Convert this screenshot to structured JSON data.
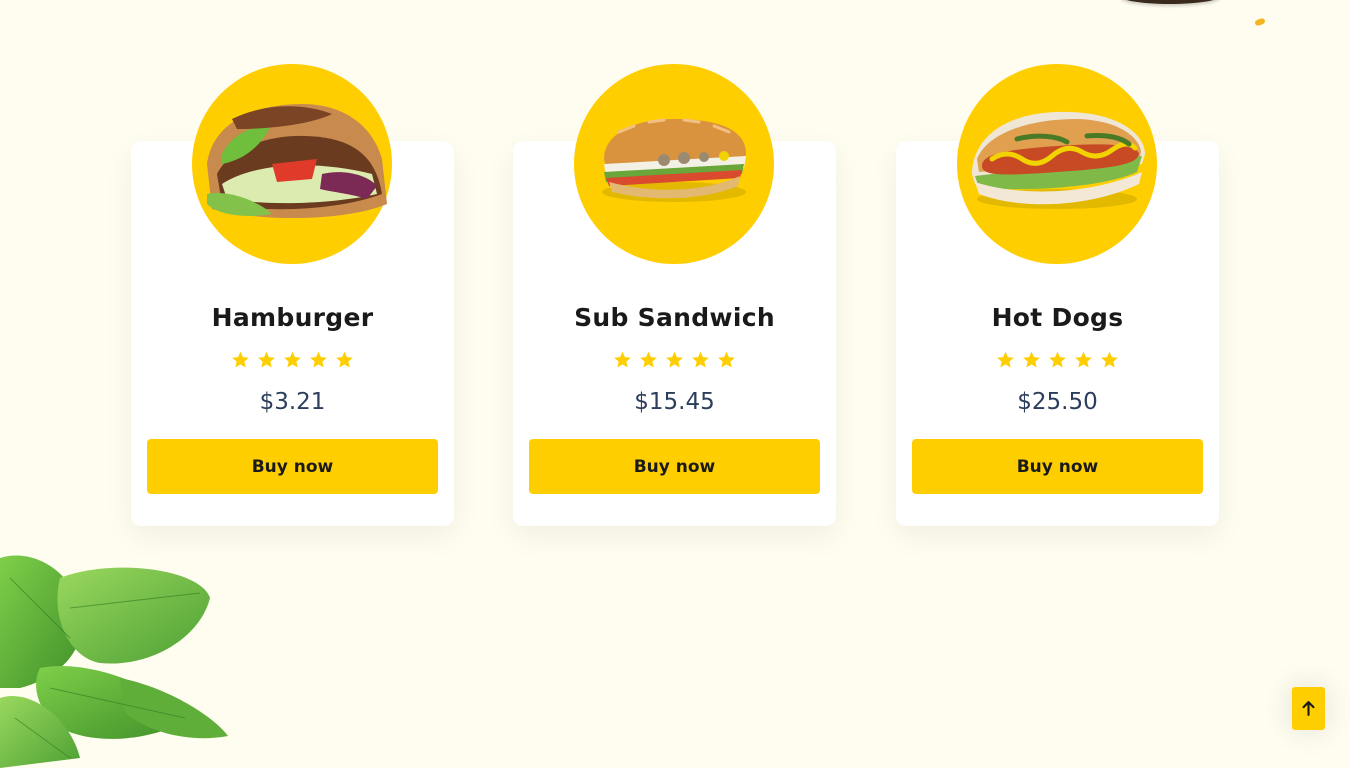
{
  "colors": {
    "background": "#fffdf0",
    "accent": "#ffce00",
    "price": "#2c3e5c",
    "star": "#ffce00"
  },
  "products": [
    {
      "name": "Hamburger",
      "rating": 5,
      "price": "$3.21",
      "button_label": "Buy now",
      "image_icon": "doner-sandwich-image"
    },
    {
      "name": "Sub Sandwich",
      "rating": 5,
      "price": "$15.45",
      "button_label": "Buy now",
      "image_icon": "sub-sandwich-image"
    },
    {
      "name": "Hot Dogs",
      "rating": 5,
      "price": "$25.50",
      "button_label": "Buy now",
      "image_icon": "hot-dog-image"
    }
  ],
  "scroll_top": {
    "icon": "arrow-up-icon"
  }
}
